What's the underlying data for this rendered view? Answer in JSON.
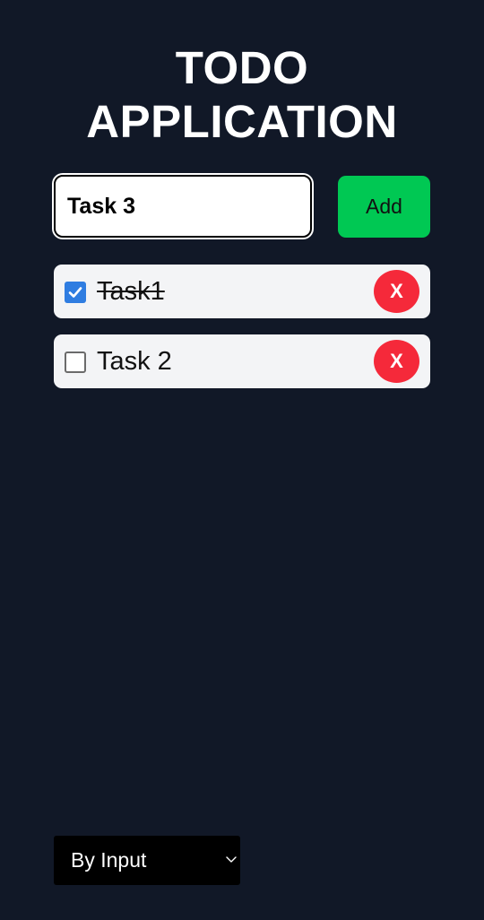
{
  "header": {
    "title_line1": "TODO",
    "title_line2": "APPLICATION"
  },
  "form": {
    "input_value": "Task 3",
    "add_label": "Add"
  },
  "tasks": [
    {
      "label": "Task1",
      "completed": true,
      "delete_label": "X"
    },
    {
      "label": "Task 2",
      "completed": false,
      "delete_label": "X"
    }
  ],
  "sort": {
    "selected": "By Input"
  },
  "colors": {
    "background": "#111827",
    "add_button": "#00c853",
    "delete_button": "#f5293a",
    "checkbox_checked": "#2f7de1",
    "task_card": "#f3f4f6"
  }
}
